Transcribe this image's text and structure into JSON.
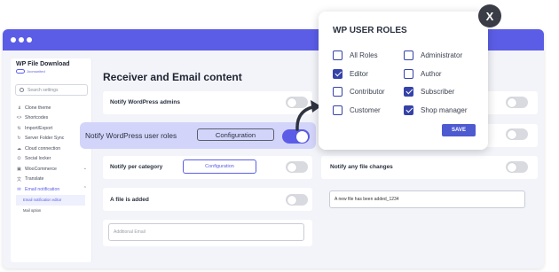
{
  "sidebar": {
    "brand": "WP File Download",
    "byline": "Joomunited",
    "search_placeholder": "Search settings",
    "items": [
      {
        "label": "Clone theme",
        "icon": "clone-icon"
      },
      {
        "label": "Shortcodes",
        "icon": "code-icon"
      },
      {
        "label": "Import/Export",
        "icon": "import-export-icon"
      },
      {
        "label": "Server Folder Sync",
        "icon": "sync-icon"
      },
      {
        "label": "Cloud connection",
        "icon": "cloud-icon"
      },
      {
        "label": "Social locker",
        "icon": "share-icon"
      },
      {
        "label": "WooCommerce",
        "icon": "woocommerce-icon"
      },
      {
        "label": "Translate",
        "icon": "translate-icon"
      },
      {
        "label": "Email notification",
        "icon": "mail-icon"
      }
    ],
    "sub_items": [
      {
        "label": "Email notification editor"
      },
      {
        "label": "Mail option"
      }
    ]
  },
  "main": {
    "title": "Receiver and Email content",
    "notify_admins": "Notify WordPress admins",
    "notify_user_roles": "Notify WordPress user roles",
    "notify_user_roles_button": "Configuration",
    "notify_per_category": "Notify per category",
    "notify_per_category_button": "Configuration",
    "notify_any_file_changes": "Notify any file changes",
    "file_added": "A file is added",
    "file_added_message": "A new file has been added_1234",
    "additional_email_placeholder": "Additional Email"
  },
  "toggles": {
    "notify_admins": false,
    "notify_user_roles": true,
    "notify_per_category": false,
    "notify_any_file_changes": false,
    "file_added": false,
    "right_top": false,
    "right_mid": false
  },
  "popup": {
    "title": "WP USER ROLES",
    "roles": [
      {
        "label": "All Roles",
        "checked": false
      },
      {
        "label": "Administrator",
        "checked": false
      },
      {
        "label": "Editor",
        "checked": true
      },
      {
        "label": "Author",
        "checked": false
      },
      {
        "label": "Contributor",
        "checked": false
      },
      {
        "label": "Subscriber",
        "checked": true
      },
      {
        "label": "Customer",
        "checked": false
      },
      {
        "label": "Shop manager",
        "checked": true
      }
    ],
    "save_label": "SAVE",
    "close_label": "X"
  },
  "colors": {
    "accent": "#5b5de6",
    "highlight": "#d3d4fa",
    "checkbox": "#3542a8"
  }
}
